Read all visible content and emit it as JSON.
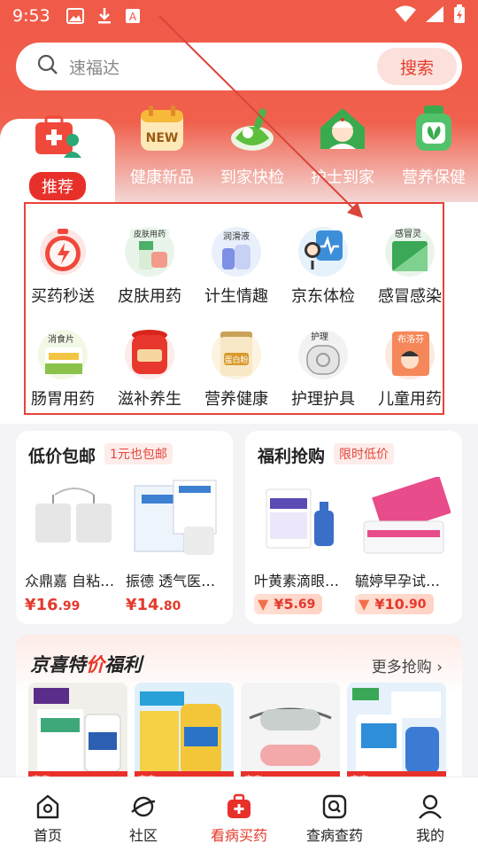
{
  "status_bar": {
    "time": "9:53"
  },
  "search": {
    "placeholder": "速福达",
    "button": "搜索"
  },
  "categories": [
    {
      "label": "推荐",
      "icon": "medical-kit-icon",
      "active": true
    },
    {
      "label": "健康新品",
      "icon": "new-calendar-icon",
      "badge": "NEW"
    },
    {
      "label": "到家快检",
      "icon": "test-tube-icon"
    },
    {
      "label": "护士到家",
      "icon": "nurse-icon"
    },
    {
      "label": "营养保健",
      "icon": "supplement-bottle-icon"
    }
  ],
  "grid": [
    {
      "label": "买药秒送",
      "icon": "alarm-clock-icon"
    },
    {
      "label": "皮肤用药",
      "icon": "skin-ointment-icon",
      "tag": "皮肤用药"
    },
    {
      "label": "计生情趣",
      "icon": "lubricant-icon",
      "tag": "润滑液"
    },
    {
      "label": "京东体检",
      "icon": "doctor-checkup-icon"
    },
    {
      "label": "感冒感染",
      "icon": "cold-medicine-icon",
      "tag": "感冒灵"
    },
    {
      "label": "肠胃用药",
      "icon": "digestive-pills-icon",
      "tag": "消食片"
    },
    {
      "label": "滋补养生",
      "icon": "tonic-jar-icon"
    },
    {
      "label": "营养健康",
      "icon": "protein-powder-icon",
      "tag": "蛋白粉"
    },
    {
      "label": "护理护具",
      "icon": "knee-brace-icon",
      "tag": "护理"
    },
    {
      "label": "儿童用药",
      "icon": "child-medicine-icon",
      "tag": "布洛芬"
    }
  ],
  "cards": [
    {
      "title": "低价包邮",
      "tag": "1元也包邮",
      "products": [
        {
          "name": "众鼎嘉 自粘…",
          "price": "16",
          "cents": ".99",
          "currency": "¥"
        },
        {
          "name": "振德 透气医…",
          "price": "14",
          "cents": ".80",
          "currency": "¥"
        }
      ]
    },
    {
      "title": "福利抢购",
      "tag": "限时低价",
      "products": [
        {
          "name": "叶黄素滴眼…",
          "price": "5",
          "cents": ".69",
          "currency": "¥"
        },
        {
          "name": "毓婷早孕试…",
          "price": "10",
          "cents": ".90",
          "currency": "¥"
        }
      ]
    }
  ],
  "jingxi": {
    "title_a": "京喜特",
    "title_b": "价",
    "title_c": "福利",
    "more": "更多抢购 ›",
    "thumb_tags": [
      "京喜",
      "京喜",
      "京喜",
      "京喜"
    ]
  },
  "bottom_nav": [
    {
      "label": "首页",
      "icon": "home-icon"
    },
    {
      "label": "社区",
      "icon": "planet-icon"
    },
    {
      "label": "看病买药",
      "icon": "medical-bag-icon",
      "active": true
    },
    {
      "label": "查病查药",
      "icon": "search-box-icon"
    },
    {
      "label": "我的",
      "icon": "person-icon"
    }
  ],
  "colors": {
    "brand_red": "#e8302a",
    "header": "#f05a48"
  }
}
